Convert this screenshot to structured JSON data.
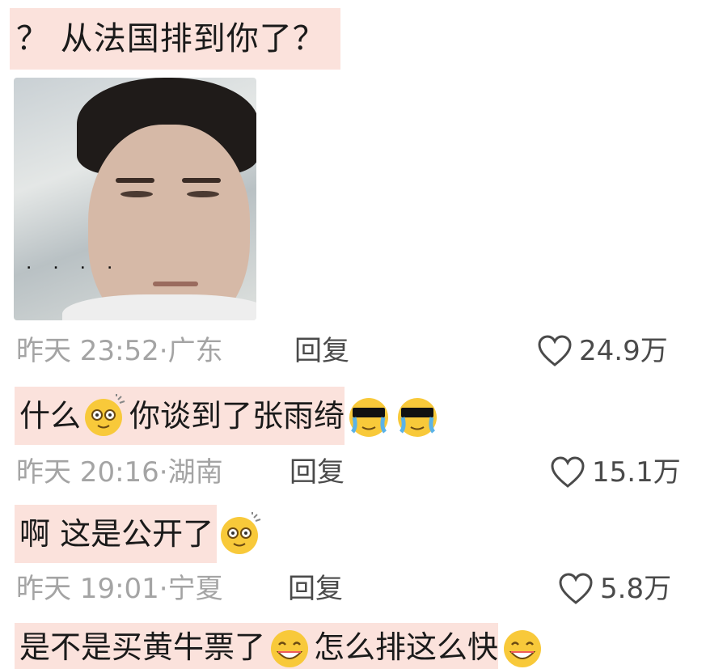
{
  "comments": [
    {
      "text": "？ 从法国排到你了？",
      "time": "昨天 23:52·",
      "location": "广东",
      "reply_label": "回复",
      "likes": "24.9万"
    },
    {
      "text_part1": "什么",
      "text_part2": "你谈到了张雨绮",
      "time": "昨天 20:16·",
      "location": "湖南",
      "reply_label": "回复",
      "likes": "15.1万"
    },
    {
      "text": "啊 这是公开了",
      "time": "昨天 19:01·",
      "location": "宁夏",
      "reply_label": "回复",
      "likes": "5.8万"
    },
    {
      "text_part1": "是不是买黄牛票了",
      "text_part2": "怎么排这么快"
    }
  ],
  "photo_dots": "....",
  "colors": {
    "highlight": "#fbe2dc",
    "meta_gray": "#a4a4a4",
    "dark_text": "#4a4a4a",
    "emoji_yellow": "#f8c93a"
  }
}
